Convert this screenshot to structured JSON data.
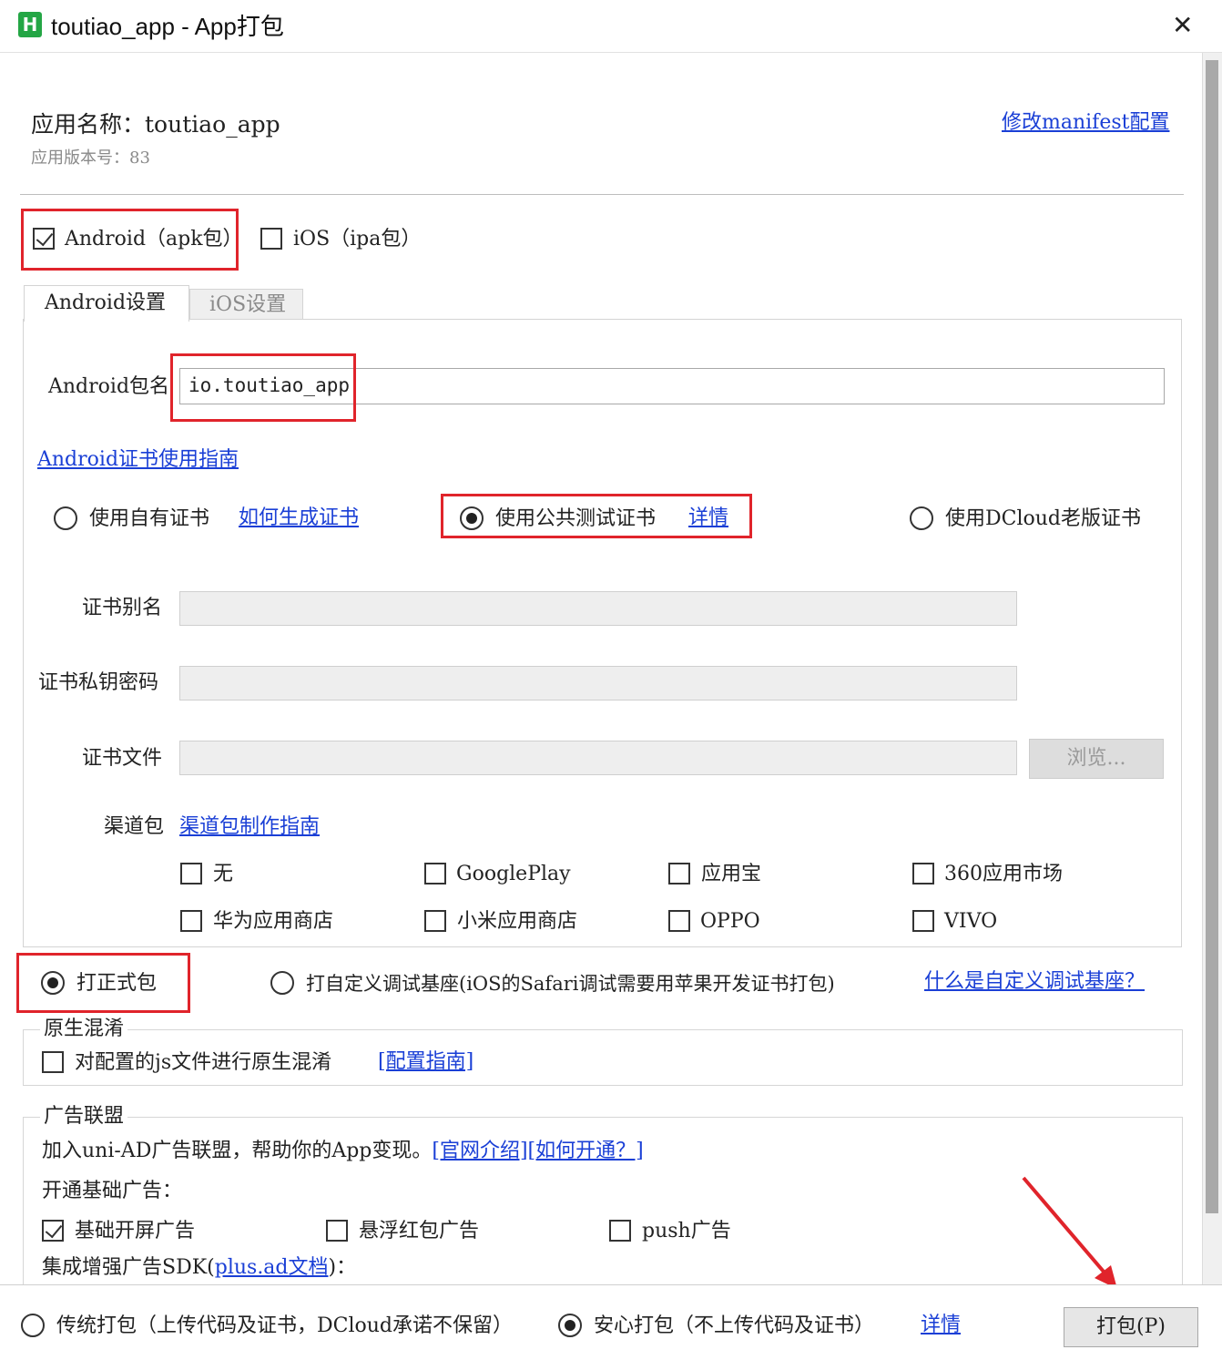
{
  "window": {
    "app_icon": "hbuilder-h-icon",
    "title": "toutiao_app - App打包",
    "close_glyph": "✕"
  },
  "header": {
    "app_name": "应用名称：toutiao_app",
    "version": "应用版本号：83",
    "manifest_link": "修改manifest配置"
  },
  "platforms": {
    "android": {
      "label": "Android（apk包）",
      "checked": true
    },
    "ios": {
      "label": "iOS（ipa包）",
      "checked": false
    }
  },
  "tabs": [
    {
      "label": "Android设置",
      "active": true
    },
    {
      "label": "iOS设置",
      "active": false
    }
  ],
  "android": {
    "package_label": "Android包名",
    "package_value": "io.toutiao_app",
    "cert_guide_link": "Android证书使用指南",
    "cert_options": {
      "own": {
        "label": "使用自有证书",
        "link": "如何生成证书",
        "selected": false
      },
      "public": {
        "label": "使用公共测试证书",
        "link": "详情",
        "selected": true
      },
      "dcloud": {
        "label": "使用DCloud老版证书",
        "selected": false
      }
    },
    "cert_alias_label": "证书别名",
    "cert_password_label": "证书私钥密码",
    "cert_file_label": "证书文件",
    "browse_button": "浏览...",
    "channel_label": "渠道包",
    "channel_guide_link": "渠道包制作指南",
    "channels": [
      {
        "label": "无",
        "checked": false
      },
      {
        "label": "GooglePlay",
        "checked": false
      },
      {
        "label": "应用宝",
        "checked": false
      },
      {
        "label": "360应用市场",
        "checked": false
      },
      {
        "label": "华为应用商店",
        "checked": false
      },
      {
        "label": "小米应用商店",
        "checked": false
      },
      {
        "label": "OPPO",
        "checked": false
      },
      {
        "label": "VIVO",
        "checked": false
      }
    ]
  },
  "package_type": {
    "release": {
      "label": "打正式包",
      "selected": true
    },
    "custom_base": {
      "label": "打自定义调试基座(iOS的Safari调试需要用苹果开发证书打包)",
      "selected": false
    },
    "custom_base_link": "什么是自定义调试基座？"
  },
  "obfuscation": {
    "legend": "原生混淆",
    "checkbox_label": "对配置的js文件进行原生混淆",
    "checked": false,
    "guide_link": "[配置指南]"
  },
  "ads": {
    "legend": "广告联盟",
    "intro": "加入uni-AD广告联盟，帮助你的App变现。",
    "intro_link": "[官网介绍][如何开通？]",
    "basic_label": "开通基础广告：",
    "basic_ads": [
      {
        "label": "基础开屏广告",
        "checked": true
      },
      {
        "label": "悬浮红包广告",
        "checked": false
      },
      {
        "label": "push广告",
        "checked": false
      }
    ],
    "sdk_label_prefix": "集成增强广告SDK(",
    "sdk_link": "plus.ad文档",
    "sdk_label_suffix": ")："
  },
  "footer": {
    "traditional": {
      "label": "传统打包（上传代码及证书，DCloud承诺不保留）",
      "selected": false
    },
    "safe": {
      "label": "安心打包（不上传代码及证书）",
      "selected": true
    },
    "details_link": "详情",
    "build_button": "打包(P)"
  },
  "colors": {
    "highlight": "#e0242b",
    "link": "#1a3fd6",
    "icon_green": "#24a645"
  }
}
